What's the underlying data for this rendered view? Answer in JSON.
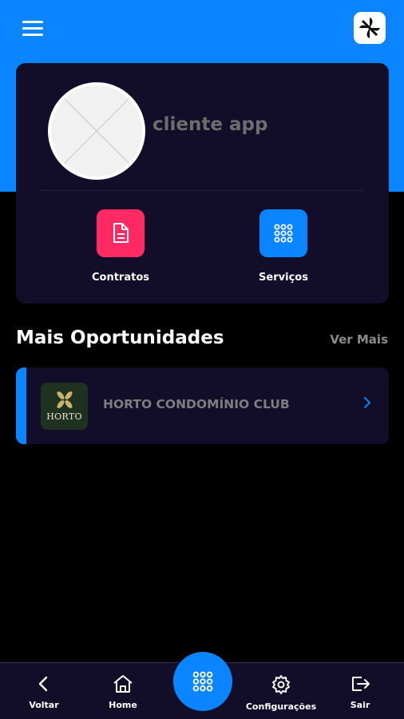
{
  "colors": {
    "brand_blue": "#0a84ff",
    "card_bg": "#120d29",
    "contracts_pink": "#ff2a63",
    "page_bg": "#000000"
  },
  "header": {
    "menu_icon": "hamburger-menu-icon",
    "logo_icon": "pinwheel-logo-icon"
  },
  "profile": {
    "name": "cliente app",
    "avatar_icon": "avatar-placeholder-icon",
    "actions": [
      {
        "label": "Contratos",
        "icon": "document-icon"
      },
      {
        "label": "Serviços",
        "icon": "grid-dots-icon"
      }
    ]
  },
  "opportunities": {
    "title": "Mais Oportunidades",
    "see_more": "Ver Mais",
    "items": [
      {
        "title": "HORTO CONDOMÍNIO CLUB",
        "thumb_text": "HORTO",
        "icon": "chevron-right-icon"
      }
    ]
  },
  "bottom_nav": {
    "items": [
      {
        "label": "Voltar",
        "icon": "chevron-left-icon"
      },
      {
        "label": "Home",
        "icon": "home-icon"
      },
      {
        "label": "Configurações",
        "icon": "gear-icon"
      },
      {
        "label": "Sair",
        "icon": "logout-icon"
      }
    ],
    "fab_icon": "grid-dots-icon"
  }
}
